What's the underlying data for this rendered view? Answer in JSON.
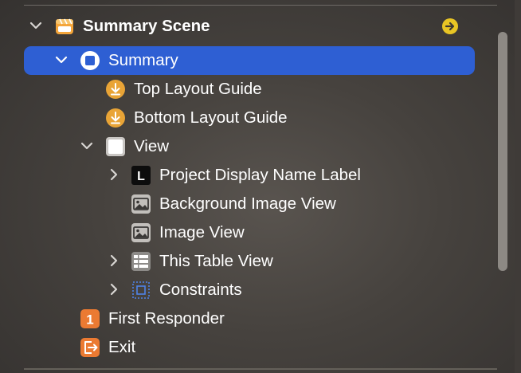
{
  "outline": {
    "scene_title": "Summary Scene",
    "items": [
      {
        "label": "Summary"
      },
      {
        "label": "Top Layout Guide"
      },
      {
        "label": "Bottom Layout Guide"
      },
      {
        "label": "View"
      },
      {
        "label": "Project Display Name Label",
        "icon_text": "L"
      },
      {
        "label": "Background Image View"
      },
      {
        "label": "Image View"
      },
      {
        "label": "This Table View"
      },
      {
        "label": "Constraints"
      },
      {
        "label": "First Responder",
        "icon_text": "1"
      },
      {
        "label": "Exit"
      }
    ]
  },
  "colors": {
    "selection": "#2e5fd3",
    "layout_guide_icon": "#e9a436",
    "responder_icon": "#eb7a32",
    "scene_icon": "#f4a53a"
  },
  "icons": {
    "scene": "scene-clapper-icon",
    "go_to": "arrow-circle-right-icon",
    "view_controller": "view-controller-icon",
    "layout_guide": "arrow-down-circle-icon",
    "view": "view-square-icon",
    "label": "label-L-icon",
    "image_view": "image-view-icon",
    "table_view": "table-view-icon",
    "constraints": "constraints-icon",
    "first_responder": "first-responder-icon",
    "exit": "exit-icon"
  }
}
